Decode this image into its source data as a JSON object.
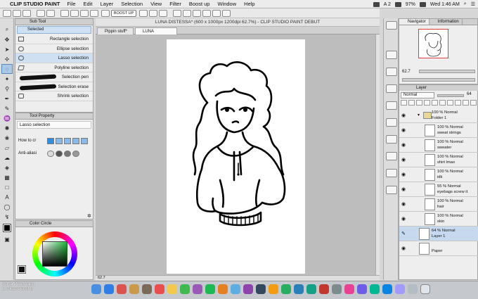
{
  "menubar": {
    "app_name": "CLIP STUDIO PAINT",
    "items": [
      "File",
      "Edit",
      "Layer",
      "Selection",
      "View",
      "Filter",
      "Boost up",
      "Window",
      "Help"
    ],
    "battery": "97%",
    "clock": "Wed 1:46 AM",
    "badge": "A 2"
  },
  "toolbar": {
    "boost_label": "BOOST UP"
  },
  "window_title": "LUNA DISTESSA* (600 x 1000px 1200dpi 62.7%) - CLIP STUDIO PAINT DEBUT",
  "doc_tabs": [
    {
      "label": "Pippin stuff*"
    },
    {
      "label": "LUNA DISTESSA*"
    }
  ],
  "sub_tool": {
    "panel_title": "Sub Tool",
    "selected_label": "Selected",
    "items": [
      {
        "label": "Rectangle selection"
      },
      {
        "label": "Ellipse selection"
      },
      {
        "label": "Lasso selection"
      },
      {
        "label": "Polyline selection"
      },
      {
        "label": "Selection pen"
      },
      {
        "label": "Selection erase"
      },
      {
        "label": "Shrink selection"
      }
    ]
  },
  "tool_property": {
    "panel_title": "Tool Property",
    "current_tool": "Lasso selection",
    "how_to_label": "How to cr",
    "antialias_label": "Anti-aliasi"
  },
  "color_circle": {
    "panel_title": "Color Circle"
  },
  "navigator": {
    "tabs": [
      "Navigator",
      "Information"
    ],
    "zoom": "62.7"
  },
  "layer_panel": {
    "title": "Layer",
    "blend_mode": "Normal",
    "opacity": "64",
    "layers": [
      {
        "line1": "100 % Normal",
        "line2": "Folder 1",
        "kind": "folder"
      },
      {
        "line1": "100 % Normal",
        "line2": "sweat strings",
        "kind": "layer"
      },
      {
        "line1": "100 % Normal",
        "line2": "sweater",
        "kind": "layer"
      },
      {
        "line1": "100 % Normal",
        "line2": "shirt lmao",
        "kind": "layer"
      },
      {
        "line1": "100 % Normal",
        "line2": "idk",
        "kind": "layer"
      },
      {
        "line1": "55 % Normal",
        "line2": "eyebags screw it",
        "kind": "layer"
      },
      {
        "line1": "100 % Normal",
        "line2": "hair",
        "kind": "layer"
      },
      {
        "line1": "100 % Normal",
        "line2": "skin",
        "kind": "layer"
      },
      {
        "line1": "64 % Normal",
        "line2": "Layer 1",
        "kind": "selected"
      },
      {
        "line1": "",
        "line2": "Paper",
        "kind": "paper"
      }
    ]
  },
  "status": {
    "zoom": "62.7"
  },
  "watermark": {
    "line1": "Soha Peachapp",
    "line2": "Lockscreenshp"
  },
  "colors": {
    "accent": "#aac8e8",
    "selection": "#c6d9ef",
    "nav_frame": "#e23b3b"
  }
}
